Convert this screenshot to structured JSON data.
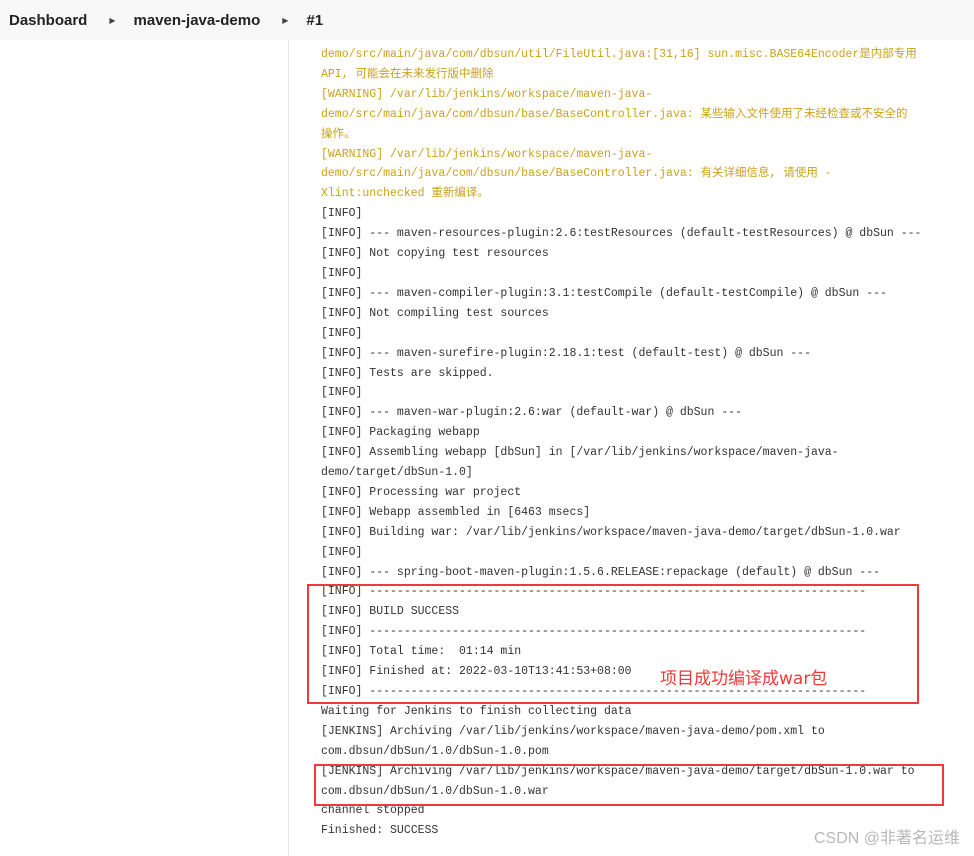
{
  "breadcrumb": [
    "Dashboard",
    "maven-java-demo",
    "#1"
  ],
  "console_lines": [
    {
      "t": "demo/src/main/java/com/dbsun/util/FileUtil.java:[31,16] sun.misc.BASE64Encoder是内部专用",
      "w": true
    },
    {
      "t": "API, 可能会在未来发行版中删除",
      "w": true
    },
    {
      "t": "[WARNING] /var/lib/jenkins/workspace/maven-java-",
      "w": true
    },
    {
      "t": "demo/src/main/java/com/dbsun/base/BaseController.java: 某些输入文件使用了未经检查或不安全的",
      "w": true
    },
    {
      "t": "操作。",
      "w": true
    },
    {
      "t": "[WARNING] /var/lib/jenkins/workspace/maven-java-",
      "w": true
    },
    {
      "t": "demo/src/main/java/com/dbsun/base/BaseController.java: 有关详细信息, 请使用 -",
      "w": true
    },
    {
      "t": "Xlint:unchecked 重新编译。",
      "w": true
    },
    {
      "t": "[INFO]"
    },
    {
      "t": "[INFO] --- maven-resources-plugin:2.6:testResources (default-testResources) @ dbSun ---"
    },
    {
      "t": "[INFO] Not copying test resources"
    },
    {
      "t": "[INFO]"
    },
    {
      "t": "[INFO] --- maven-compiler-plugin:3.1:testCompile (default-testCompile) @ dbSun ---"
    },
    {
      "t": "[INFO] Not compiling test sources"
    },
    {
      "t": "[INFO]"
    },
    {
      "t": "[INFO] --- maven-surefire-plugin:2.18.1:test (default-test) @ dbSun ---"
    },
    {
      "t": "[INFO] Tests are skipped."
    },
    {
      "t": "[INFO]"
    },
    {
      "t": "[INFO] --- maven-war-plugin:2.6:war (default-war) @ dbSun ---"
    },
    {
      "t": "[INFO] Packaging webapp"
    },
    {
      "t": "[INFO] Assembling webapp [dbSun] in [/var/lib/jenkins/workspace/maven-java-"
    },
    {
      "t": "demo/target/dbSun-1.0]"
    },
    {
      "t": "[INFO] Processing war project"
    },
    {
      "t": "[INFO] Webapp assembled in [6463 msecs]"
    },
    {
      "t": "[INFO] Building war: /var/lib/jenkins/workspace/maven-java-demo/target/dbSun-1.0.war"
    },
    {
      "t": "[INFO]"
    },
    {
      "t": "[INFO] --- spring-boot-maven-plugin:1.5.6.RELEASE:repackage (default) @ dbSun ---"
    },
    {
      "t": "[INFO] ------------------------------------------------------------------------"
    },
    {
      "t": "[INFO] BUILD SUCCESS"
    },
    {
      "t": "[INFO] ------------------------------------------------------------------------"
    },
    {
      "t": "[INFO] Total time:  01:14 min"
    },
    {
      "t": "[INFO] Finished at: 2022-03-10T13:41:53+08:00"
    },
    {
      "t": "[INFO] ------------------------------------------------------------------------"
    },
    {
      "t": "Waiting for Jenkins to finish collecting data"
    },
    {
      "t": "[JENKINS] Archiving /var/lib/jenkins/workspace/maven-java-demo/pom.xml to"
    },
    {
      "t": "com.dbsun/dbSun/1.0/dbSun-1.0.pom"
    },
    {
      "t": "[JENKINS] Archiving /var/lib/jenkins/workspace/maven-java-demo/target/dbSun-1.0.war to"
    },
    {
      "t": "com.dbsun/dbSun/1.0/dbSun-1.0.war"
    },
    {
      "t": "channel stopped"
    },
    {
      "t": "Finished: SUCCESS"
    }
  ],
  "annotation": "项目成功编译成war包",
  "watermark": "CSDN @非著名运维",
  "colors": {
    "warning": "#c9a21a",
    "highlight_box": "#f03a3a"
  }
}
